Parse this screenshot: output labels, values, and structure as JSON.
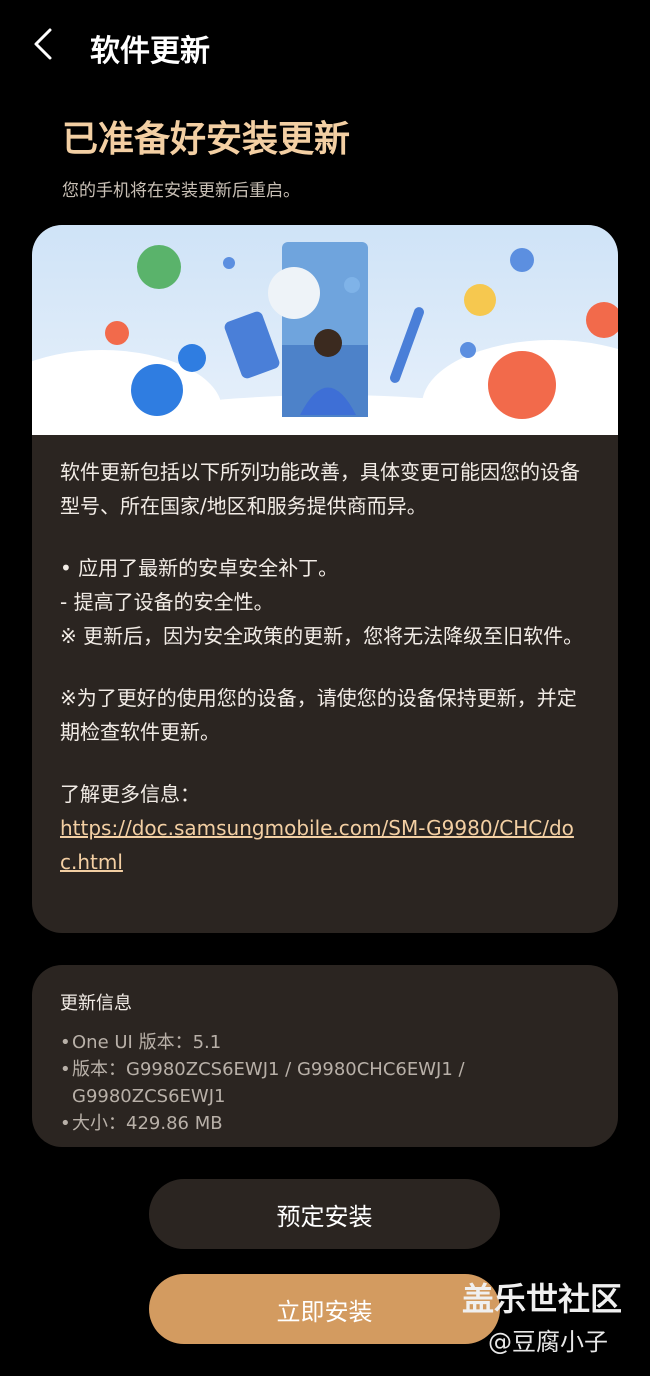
{
  "header": {
    "title": "软件更新",
    "back_icon": "chevron-left-icon"
  },
  "main": {
    "heading": "已准备好安装更新",
    "subheading": "您的手机将在安装更新后重启。"
  },
  "details": {
    "banner_image": "illustration-phone-update",
    "intro": "软件更新包括以下所列功能改善，具体变更可能因您的设备型号、所在国家/地区和服务提供商而异。",
    "item1": "• 应用了最新的安卓安全补丁。",
    "item1_sub": " - 提高了设备的安全性。",
    "note1": "※ 更新后，因为安全政策的更新，您将无法降级至旧软件。",
    "note2": "※为了更好的使用您的设备，请使您的设备保持更新，并定期检查软件更新。",
    "more_label": "了解更多信息：",
    "more_link": "https://doc.samsungmobile.com/SM-G9980/CHC/doc.html"
  },
  "update_info": {
    "title": "更新信息",
    "one_ui": "One UI 版本：5.1",
    "version": "版本：G9980ZCS6EWJ1 / G9980CHC6EWJ1 / G9980ZCS6EWJ1",
    "size": "大小：429.86 MB"
  },
  "buttons": {
    "schedule": "预定安装",
    "install_now": "立即安装"
  },
  "watermark": {
    "line1": "盖乐世社区",
    "line2": "@豆腐小子"
  },
  "colors": {
    "accent": "#f3cfa3",
    "card_bg": "#2b2521",
    "install_button": "#d39b60",
    "background": "#000000"
  }
}
